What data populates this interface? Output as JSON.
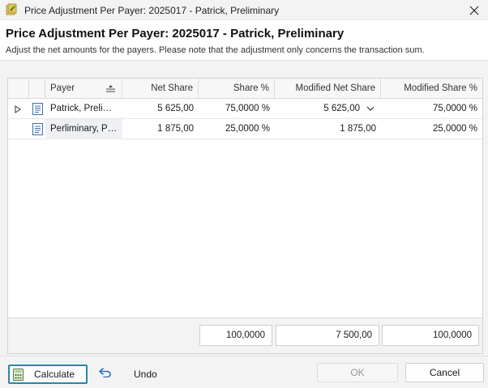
{
  "window": {
    "title": "Price Adjustment Per Payer: 2025017 - Patrick, Preliminary"
  },
  "header": {
    "title": "Price Adjustment Per Payer: 2025017 - Patrick, Preliminary",
    "subtitle": "Adjust the net amounts for the payers. Please note that the adjustment only concerns the transaction sum."
  },
  "grid": {
    "columns": [
      "Payer",
      "Net Share",
      "Share %",
      "Modified Net Share",
      "Modified Share %"
    ],
    "rows": [
      {
        "payer": "Patrick, Preliminary",
        "net_share": "5 625,00",
        "share_pct": "75,0000 %",
        "modified_net_share": "5 625,00",
        "modified_share_pct": "75,0000 %"
      },
      {
        "payer": "Perliminary, Patrick",
        "net_share": "1 875,00",
        "share_pct": "25,0000 %",
        "modified_net_share": "1 875,00",
        "modified_share_pct": "25,0000 %"
      }
    ],
    "totals": {
      "share_pct": "100,0000",
      "modified_net_share": "7 500,00",
      "modified_share_pct": "100,0000"
    }
  },
  "footer": {
    "calculate_label": "Calculate",
    "undo_label": "Undo",
    "ok_label": "OK",
    "cancel_label": "Cancel"
  },
  "icons": {
    "app": "price-tag-icon",
    "close": "close-icon",
    "sort": "sort-icon",
    "expand": "expand-arrow-icon",
    "row": "document-icon",
    "dropdown": "chevron-down-icon",
    "calculate": "calculator-icon",
    "undo": "undo-icon"
  },
  "colors": {
    "accent": "#2a86a8",
    "undo": "#2f6fd6"
  }
}
